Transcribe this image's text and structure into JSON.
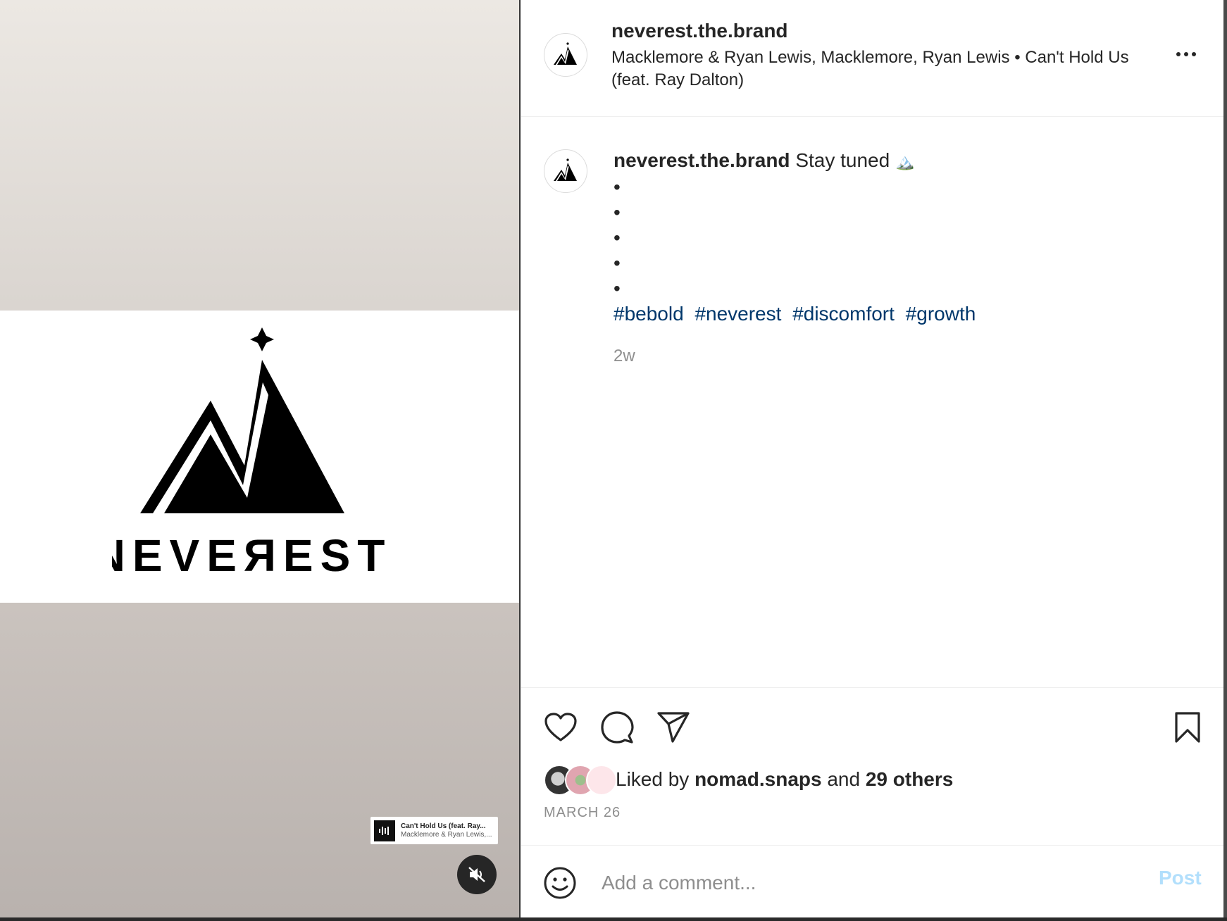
{
  "media": {
    "logo_wordmark": "NEVERest",
    "music_chip": {
      "song": "Can't Hold Us (feat. Ray...",
      "artist": "Macklemore & Ryan Lewis,..."
    },
    "mute_icon": "speaker-muted-icon"
  },
  "header": {
    "username": "neverest.the.brand",
    "audio": "Macklemore & Ryan Lewis, Macklemore, Ryan Lewis • Can't Hold Us (feat. Ray Dalton)",
    "more_icon": "more-horizontal-icon"
  },
  "caption": {
    "username": "neverest.the.brand",
    "text": "Stay tuned",
    "emoji": "🏔️",
    "bullets": [
      "•",
      "•",
      "•",
      "•",
      "•"
    ],
    "hashtags": [
      "#bebold",
      "#neverest",
      "#discomfort",
      "#growth"
    ],
    "time_ago": "2w"
  },
  "actions": {
    "icons": [
      "heart-icon",
      "comment-icon",
      "share-icon",
      "bookmark-icon"
    ],
    "likes_prefix": "Liked by",
    "liked_by_user": "nomad.snaps",
    "likes_and": "and",
    "likes_others": "29 others",
    "date": "MARCH 26"
  },
  "comment": {
    "placeholder": "Add a comment...",
    "post_label": "Post"
  },
  "colors": {
    "hashtag": "#00376b",
    "post_button_disabled": "#b2dffc",
    "muted_text": "#8e8e8e"
  }
}
